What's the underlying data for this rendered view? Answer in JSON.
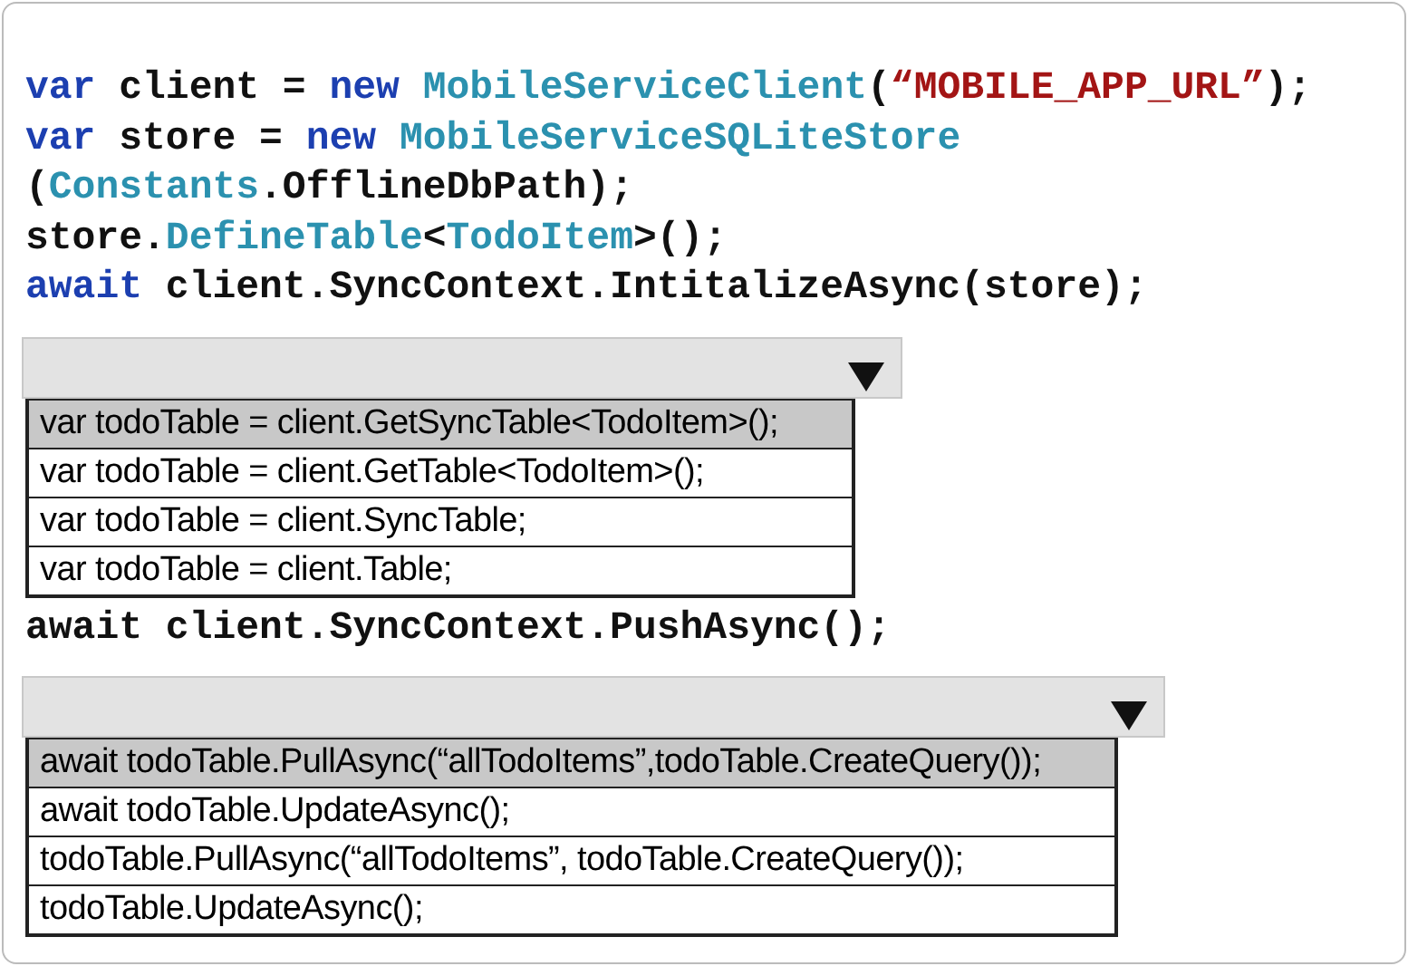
{
  "blocks": [
    {
      "kind": "code",
      "lines": [
        [
          {
            "kind": "keyword",
            "text": "var"
          },
          {
            "kind": "plain",
            "text": " client = "
          },
          {
            "kind": "keyword",
            "text": "new"
          },
          {
            "kind": "type",
            "text": " MobileServiceClient"
          },
          {
            "kind": "plain",
            "text": "("
          },
          {
            "kind": "string",
            "text": "“MOBILE_APP_URL”"
          },
          {
            "kind": "plain",
            "text": ");"
          }
        ],
        [
          {
            "kind": "keyword",
            "text": "var"
          },
          {
            "kind": "plain",
            "text": " store = "
          },
          {
            "kind": "keyword",
            "text": "new"
          },
          {
            "kind": "type",
            "text": " MobileServiceSQLiteStore"
          }
        ],
        [
          {
            "kind": "plain",
            "text": "("
          },
          {
            "kind": "type",
            "text": "Constants"
          },
          {
            "kind": "plain",
            "text": ".OfflineDbPath);"
          }
        ],
        [
          {
            "kind": "plain",
            "text": "store."
          },
          {
            "kind": "type",
            "text": "DefineTable"
          },
          {
            "kind": "plain",
            "text": "<"
          },
          {
            "kind": "type",
            "text": "TodoItem"
          },
          {
            "kind": "plain",
            "text": ">();"
          }
        ],
        [
          {
            "kind": "keyword",
            "text": "await"
          },
          {
            "kind": "plain",
            "text": " client.SyncContext.IntitalizeAsync(store);"
          }
        ]
      ]
    },
    {
      "kind": "dropdown",
      "options": [
        {
          "text": "var todoTable = client.GetSyncTable<TodoItem>();",
          "selected": true
        },
        {
          "text": "var todoTable = client.GetTable<TodoItem>();",
          "selected": false
        },
        {
          "text": "var todoTable = client.SyncTable;",
          "selected": false
        },
        {
          "text": "var todoTable = client.Table;",
          "selected": false
        }
      ]
    },
    {
      "kind": "code",
      "lines": [
        [
          {
            "kind": "plain",
            "text": "await client.SyncContext.PushAsync();"
          }
        ]
      ]
    },
    {
      "kind": "dropdown",
      "options": [
        {
          "text": "await todoTable.PullAsync(“allTodoItems”,todoTable.CreateQuery());",
          "selected": true
        },
        {
          "text": "await todoTable.UpdateAsync();",
          "selected": false
        },
        {
          "text": "todoTable.PullAsync(“allTodoItems”, todoTable.CreateQuery());",
          "selected": false
        },
        {
          "text": "todoTable.UpdateAsync();",
          "selected": false
        }
      ]
    }
  ]
}
